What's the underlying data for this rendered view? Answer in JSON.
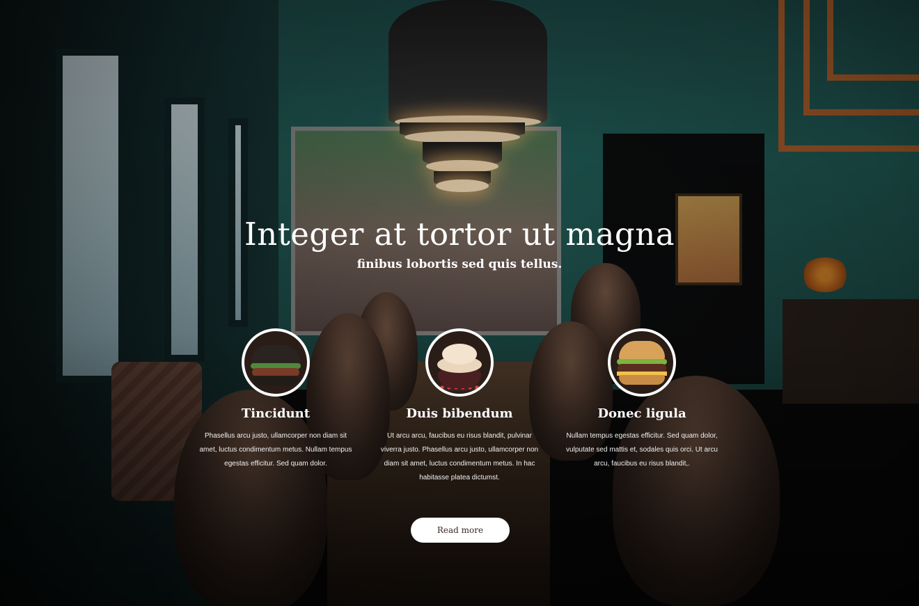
{
  "hero": {
    "title": "Integer at tortor ut magna",
    "subtitle": "finibus lobortis sed quis tellus."
  },
  "features": [
    {
      "image": "dark-burger",
      "title": "Tincidunt",
      "text": "Phasellus arcu justo, ullamcorper non diam sit amet, luctus condimentum metus. Nullam tempus egestas efficitur. Sed quam dolor."
    },
    {
      "image": "cupcake",
      "title": "Duis bibendum",
      "text": "Ut arcu arcu, faucibus eu risus blandit, pulvinar viverra justo. Phasellus arcu justo, ullamcorper non diam sit amet, luctus condimentum metus. In hac habitasse platea dictumst."
    },
    {
      "image": "burger",
      "title": "Donec ligula",
      "text": "Nullam tempus egestas efficitur. Sed quam dolor, vulputate sed mattis et, sodales quis orci. Ut arcu arcu, faucibus eu risus blandit,."
    }
  ],
  "cta": {
    "label": "Read more"
  },
  "colors": {
    "button_bg": "#ffffff",
    "button_text": "#3a2a26",
    "text": "#ffffff"
  }
}
